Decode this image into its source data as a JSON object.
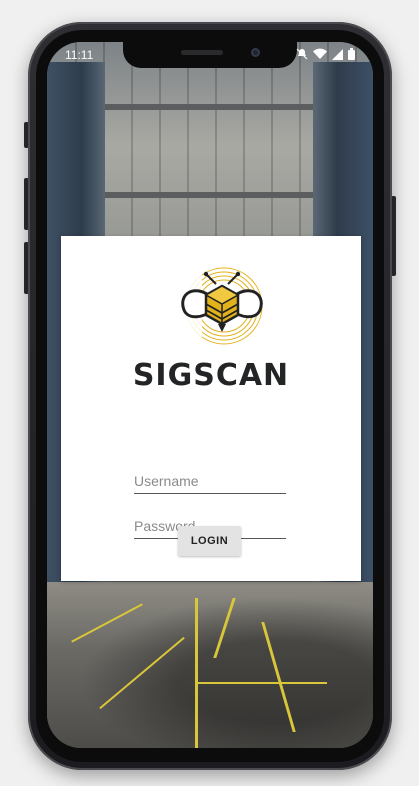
{
  "status_bar": {
    "time": "11:11",
    "icons": [
      "do-not-disturb-icon",
      "wifi-icon",
      "signal-icon",
      "battery-icon"
    ]
  },
  "app": {
    "brand_name": "SIGSCAN",
    "logo_icon": "bee-logo-icon",
    "colors": {
      "accent": "#e2b21d",
      "brand_text": "#222426",
      "card": "#ffffff"
    }
  },
  "login": {
    "username_placeholder": "Username",
    "username_value": "",
    "password_placeholder": "Password",
    "password_value": "",
    "button_label": "LOGIN"
  }
}
